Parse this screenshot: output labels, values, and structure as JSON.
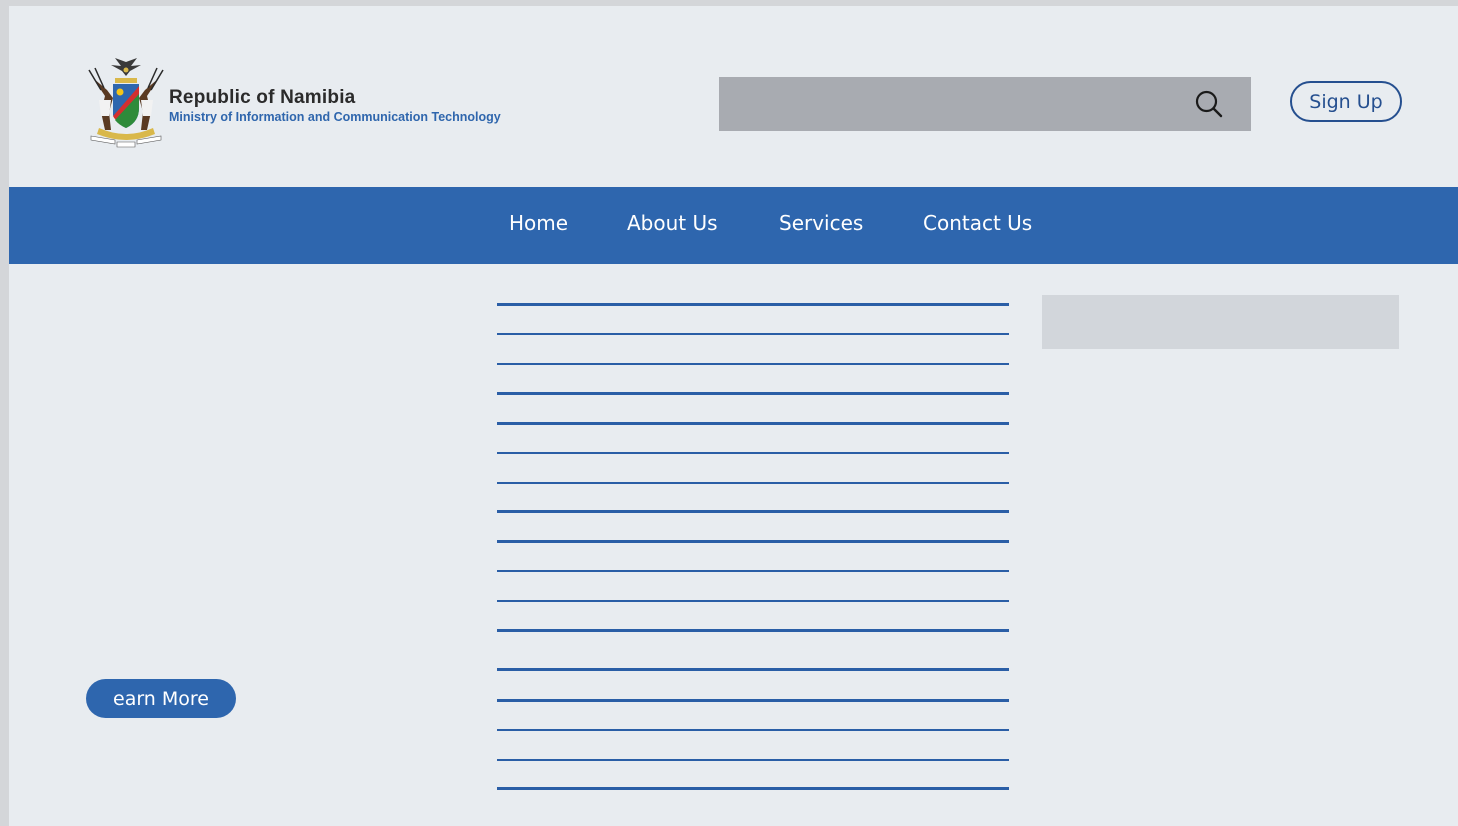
{
  "header": {
    "title": "Republic of Namibia",
    "subtitle": "Ministry of Information and Communication Technology",
    "logo_icon": "namibia-coat-of-arms-icon",
    "search": {
      "value": "",
      "placeholder": "",
      "icon": "search-icon"
    },
    "signup_label": "Sign Up"
  },
  "nav": {
    "items": [
      {
        "label": "Home"
      },
      {
        "label": "About Us"
      },
      {
        "label": "Services"
      },
      {
        "label": "Contact Us"
      }
    ]
  },
  "main": {
    "learn_more_label": "earn More"
  },
  "colors": {
    "primary": "#2e66ae",
    "primary_dark": "#254f8f",
    "background": "#e8ecf0",
    "search_bg": "#a8abb1",
    "side_box": "#d2d6db",
    "title_text": "#2b2b2b"
  }
}
